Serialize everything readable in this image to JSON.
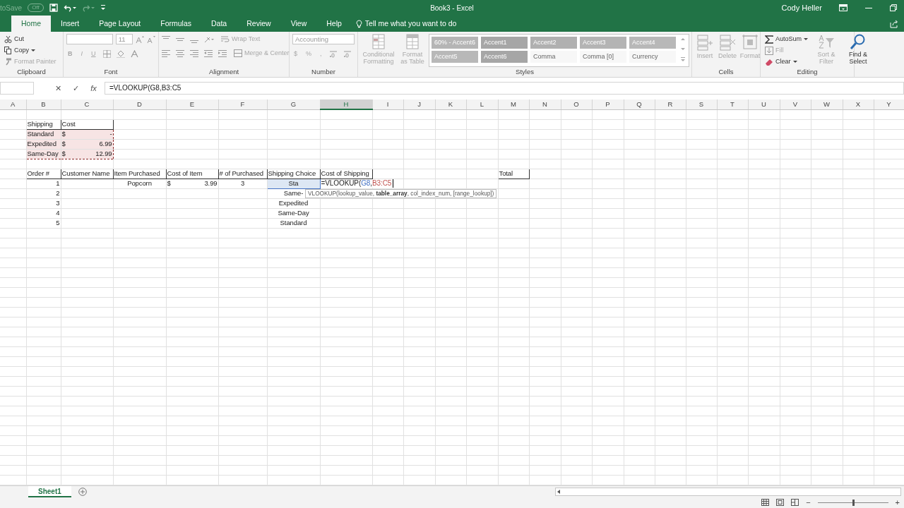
{
  "title_bar": {
    "autosave_label": "toSave",
    "autosave_state": "Off",
    "document_title": "Book3  -  Excel",
    "user": "Cody Heller"
  },
  "tabs": [
    {
      "label": "Home",
      "selected": true
    },
    {
      "label": "Insert",
      "selected": false
    },
    {
      "label": "Page Layout",
      "selected": false
    },
    {
      "label": "Formulas",
      "selected": false
    },
    {
      "label": "Data",
      "selected": false
    },
    {
      "label": "Review",
      "selected": false
    },
    {
      "label": "View",
      "selected": false
    },
    {
      "label": "Help",
      "selected": false
    }
  ],
  "tell_me": "Tell me what you want to do",
  "ribbon": {
    "groups": [
      {
        "label": "Clipboard",
        "kind": "clipboard",
        "items": [
          {
            "label": "Cut",
            "disabled": false
          },
          {
            "label": "Copy",
            "disabled": false
          },
          {
            "label": "Format Painter",
            "disabled": true
          }
        ]
      },
      {
        "label": "Font",
        "kind": "font",
        "font_size": "11",
        "buttons": [
          "B",
          "I",
          "U"
        ]
      },
      {
        "label": "Alignment",
        "kind": "alignment",
        "items": [
          {
            "label": "Wrap Text",
            "disabled": true
          },
          {
            "label": "Merge & Center",
            "disabled": true
          }
        ]
      },
      {
        "label": "Number",
        "kind": "number",
        "format": "Accounting",
        "buttons": [
          "$",
          "%",
          ","
        ]
      },
      {
        "label": "Styles",
        "kind": "styles",
        "items": [
          {
            "label": "Conditional Formatting",
            "disabled": true
          },
          {
            "label": "Format as Table",
            "disabled": true
          }
        ],
        "gallery": [
          {
            "label": "60% - Accent6",
            "color": "#b5b5b5"
          },
          {
            "label": "Accent1",
            "color": "#a6a6a6"
          },
          {
            "label": "Accent2",
            "color": "#b0b0b0"
          },
          {
            "label": "Accent3",
            "color": "#b4b4b4"
          },
          {
            "label": "Accent4",
            "color": "#b8b8b8"
          },
          {
            "label": "Accent5",
            "color": "#b8b8b8"
          },
          {
            "label": "Accent6",
            "color": "#a6a6a6"
          },
          {
            "label": "Comma",
            "color": "#f7f7f7"
          },
          {
            "label": "Comma [0]",
            "color": "#f7f7f7"
          },
          {
            "label": "Currency",
            "color": "#f7f7f7"
          }
        ]
      },
      {
        "label": "Cells",
        "kind": "cells",
        "items": [
          {
            "label": "Insert",
            "disabled": true
          },
          {
            "label": "Delete",
            "disabled": true
          },
          {
            "label": "Format",
            "disabled": true
          }
        ]
      },
      {
        "label": "Editing",
        "kind": "editing",
        "items": [
          {
            "label": "AutoSum",
            "disabled": false
          },
          {
            "label": "Fill",
            "disabled": true
          },
          {
            "label": "Clear",
            "disabled": false
          },
          {
            "label": "Sort & Filter",
            "disabled": true
          },
          {
            "label": "Find & Select",
            "disabled": false
          }
        ]
      }
    ]
  },
  "formula_bar": {
    "buttons": [
      "✕",
      "✓",
      "fx"
    ],
    "formula": "=VLOOKUP(G8,B3:C5"
  },
  "sheet": {
    "columns": [
      {
        "label": "A",
        "selected": false
      },
      {
        "label": "B",
        "selected": false
      },
      {
        "label": "C",
        "selected": false
      },
      {
        "label": "D",
        "selected": false
      },
      {
        "label": "E",
        "selected": false
      },
      {
        "label": "F",
        "selected": false
      },
      {
        "label": "G",
        "selected": false
      },
      {
        "label": "H",
        "selected": true
      },
      {
        "label": "I",
        "selected": false
      },
      {
        "label": "J",
        "selected": false
      },
      {
        "label": "K",
        "selected": false
      },
      {
        "label": "L",
        "selected": false
      },
      {
        "label": "M",
        "selected": false
      },
      {
        "label": "N",
        "selected": false
      },
      {
        "label": "O",
        "selected": false
      },
      {
        "label": "P",
        "selected": false
      },
      {
        "label": "Q",
        "selected": false
      },
      {
        "label": "R",
        "selected": false
      },
      {
        "label": "S",
        "selected": false
      },
      {
        "label": "T",
        "selected": false
      },
      {
        "label": "U",
        "selected": false
      },
      {
        "label": "V",
        "selected": false
      },
      {
        "label": "W",
        "selected": false
      },
      {
        "label": "X",
        "selected": false
      },
      {
        "label": "Y",
        "selected": false
      }
    ]
  },
  "shipping_table": {
    "columns": [
      "Shipping",
      "Cost"
    ],
    "referenced": true,
    "rows": [
      {
        "label": "Standard",
        "currency": "$",
        "amount": "-"
      },
      {
        "label": "Expedited",
        "currency": "$",
        "amount": "6.99"
      },
      {
        "label": "Same-Day",
        "currency": "$",
        "amount": "12.99"
      }
    ]
  },
  "orders_table": {
    "columns": [
      "Order #",
      "Customer Name",
      "Item Purchased",
      "Cost of Item",
      "# of Purchased",
      "Shipping Choice",
      "Cost of Shipping"
    ],
    "rows": [
      {
        "order": "1",
        "item": "Popcorn",
        "currency": "$",
        "cost": "3.99",
        "quantity": "3",
        "shipping": "Sta",
        "shipping_referenced": true
      },
      {
        "order": "2",
        "shipping": "Same-",
        "shipping_referenced": false
      },
      {
        "order": "3",
        "shipping": "Expedited",
        "shipping_referenced": false
      },
      {
        "order": "4",
        "shipping": "Same-Day",
        "shipping_referenced": false
      },
      {
        "order": "5",
        "shipping": "Standard",
        "shipping_referenced": false
      }
    ]
  },
  "total_label": "Total",
  "cell_edit": {
    "parts": [
      {
        "text": "=VLOOKUP("
      },
      {
        "text": "G8",
        "color": "#4472c4"
      },
      {
        "text": ","
      },
      {
        "text": "B3:C5",
        "color": "#c0504d"
      }
    ]
  },
  "tooltip": "VLOOKUP(lookup_value, **table_array**, col_index_num, [range_lookup])",
  "sheet_tabs": [
    {
      "label": "Sheet1",
      "selected": true
    }
  ],
  "status_bar": {
    "zoom": {
      "minus": "−",
      "plus": "+",
      "level": 0.5
    }
  }
}
